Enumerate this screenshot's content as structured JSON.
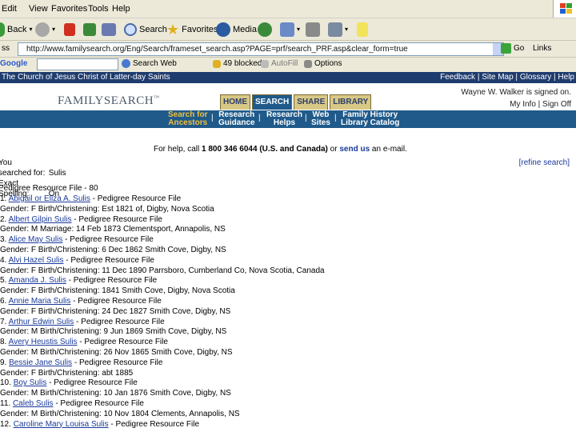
{
  "menu": [
    "Edit",
    "View",
    "Favorites",
    "Tools",
    "Help"
  ],
  "toolbar": {
    "back": "Back",
    "search": "Search",
    "favorites": "Favorites",
    "media": "Media"
  },
  "address": {
    "url": "http://www.familysearch.org/Eng/Search/frameset_search.asp?PAGE=prf/search_PRF.asp&clear_form=true",
    "go": "Go",
    "links": "Links"
  },
  "google_bar": {
    "logo": "Google",
    "search_web": "Search Web",
    "blocked": "49 blocked",
    "autofill": "AutoFill",
    "options": "Options"
  },
  "site": {
    "church": "The Church of Jesus Christ of Latter-day Saints",
    "top_links": "Feedback | Site Map | Glossary | Help",
    "logo": "FAMILYSEARCH",
    "tabs": [
      "HOME",
      "SEARCH",
      "SHARE",
      "LIBRARY"
    ],
    "active_tab": "SEARCH",
    "signed_on": "Wayne W. Walker is signed on.",
    "account_links": "My Info | Sign Off"
  },
  "subnav": [
    {
      "line1": "Search for",
      "line2": "Ancestors",
      "active": true
    },
    {
      "line1": "Research",
      "line2": "Guidance",
      "active": false
    },
    {
      "line1": "Research",
      "line2": "Helps",
      "active": false
    },
    {
      "line1": "Web",
      "line2": "Sites",
      "active": false
    },
    {
      "line1": "Family History",
      "line2": "Library Catalog",
      "active": false
    }
  ],
  "help": {
    "prefix": "For help, call ",
    "phone": "1 800 346 6044 (U.S. and Canada)",
    "middle": " or ",
    "link": "send us",
    "suffix": " an e-mail."
  },
  "searched_for": {
    "label": "You searched for:",
    "value": "Sulis",
    "exact_label": "Exact Spelling:",
    "exact_value": "On"
  },
  "refine": "[refine search]",
  "results_header": "Pedigree Resource File - 80",
  "results": [
    {
      "num": "1.",
      "name": "Abigail or Eliza A. Sulis",
      "source": " - Pedigree Resource File",
      "event": "Gender: F Birth/Christening: Est 1821 of, Digby, Nova Scotia"
    },
    {
      "num": "2.",
      "name": "Albert Gilpin Sulis",
      "source": " - Pedigree Resource File",
      "event": "Gender: M Marriage: 14 Feb 1873 Clementsport, Annapolis, NS"
    },
    {
      "num": "3.",
      "name": "Alice May Sulis",
      "source": " - Pedigree Resource File",
      "event": "Gender: F Birth/Christening: 6 Dec 1862 Smith Cove, Digby, NS"
    },
    {
      "num": "4.",
      "name": "Alvi Hazel Sulis",
      "source": " - Pedigree Resource File",
      "event": "Gender: F Birth/Christening: 11 Dec 1890 Parrsboro, Cumberland Co, Nova Scotia, Canada"
    },
    {
      "num": "5.",
      "name": "Amanda J. Sulis",
      "source": " - Pedigree Resource File",
      "event": "Gender: F Birth/Christening: 1841 Smith Cove, Digby, Nova Scotia"
    },
    {
      "num": "6.",
      "name": "Annie Maria Sulis",
      "source": " - Pedigree Resource File",
      "event": "Gender: F Birth/Christening: 24 Dec 1827 Smith Cove, Digby, NS"
    },
    {
      "num": "7.",
      "name": "Arthur Edwin Sulis",
      "source": " - Pedigree Resource File",
      "event": "Gender: M Birth/Christening: 9 Jun 1869 Smith Cove, Digby, NS"
    },
    {
      "num": "8.",
      "name": "Avery Heustis Sulis",
      "source": " - Pedigree Resource File",
      "event": "Gender: M Birth/Christening: 26 Nov 1865 Smith Cove, Digby, NS"
    },
    {
      "num": "9.",
      "name": "Bessie Jane Sulis",
      "source": " - Pedigree Resource File",
      "event": "Gender: F Birth/Christening: abt 1885"
    },
    {
      "num": "10.",
      "name": "Boy Sulis",
      "source": " - Pedigree Resource File",
      "event": "Gender: M Birth/Christening: 10 Jan 1876 Smith Cove, Digby, NS"
    },
    {
      "num": "11.",
      "name": "Caleb Sulis",
      "source": " - Pedigree Resource File",
      "event": "Gender: M Birth/Christening: 10 Nov 1804 Clements, Annapolis, NS"
    },
    {
      "num": "12.",
      "name": "Caroline Mary Louisa Sulis",
      "source": " - Pedigree Resource File",
      "event": ""
    }
  ]
}
